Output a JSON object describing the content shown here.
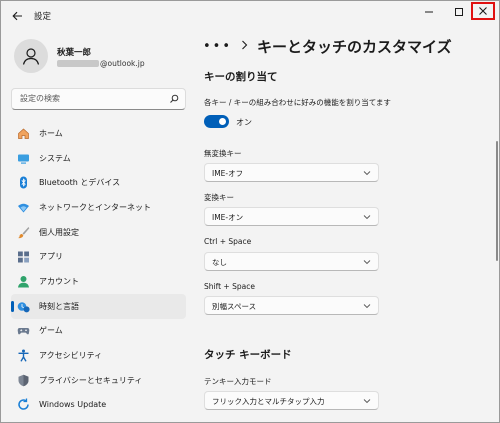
{
  "window": {
    "title": "設定"
  },
  "profile": {
    "name": "秋葉一郎",
    "email_domain": "@outlook.jp"
  },
  "search": {
    "placeholder": "設定の検索"
  },
  "nav": {
    "items": [
      {
        "label": "ホーム",
        "icon": "home-icon"
      },
      {
        "label": "システム",
        "icon": "system-icon"
      },
      {
        "label": "Bluetooth とデバイス",
        "icon": "bluetooth-icon"
      },
      {
        "label": "ネットワークとインターネット",
        "icon": "wifi-icon"
      },
      {
        "label": "個人用設定",
        "icon": "brush-icon"
      },
      {
        "label": "アプリ",
        "icon": "apps-icon"
      },
      {
        "label": "アカウント",
        "icon": "account-icon"
      },
      {
        "label": "時刻と言語",
        "icon": "time-language-icon",
        "selected": true
      },
      {
        "label": "ゲーム",
        "icon": "gamepad-icon"
      },
      {
        "label": "アクセシビリティ",
        "icon": "accessibility-icon"
      },
      {
        "label": "プライバシーとセキュリティ",
        "icon": "shield-icon"
      },
      {
        "label": "Windows Update",
        "icon": "update-icon"
      }
    ]
  },
  "content": {
    "breadcrumb_dots": "•••",
    "page_title": "キーとタッチのカスタマイズ",
    "key_assign": {
      "title": "キーの割り当て",
      "description": "各キー / キーの組み合わせに好みの機能を割り当てます",
      "toggle_label": "オン",
      "toggle_on": true
    },
    "fields": [
      {
        "label": "無変換キー",
        "value": "IME-オフ"
      },
      {
        "label": "変換キー",
        "value": "IME-オン"
      },
      {
        "label": "Ctrl + Space",
        "value": "なし"
      },
      {
        "label": "Shift + Space",
        "value": "別幅スペース"
      }
    ],
    "touch_keyboard": {
      "title": "タッチ キーボード",
      "field_label": "テンキー入力モード",
      "field_value": "フリック入力とマルチタップ入力"
    }
  },
  "colors": {
    "accent": "#005fb8",
    "close_highlight": "#e01010"
  }
}
